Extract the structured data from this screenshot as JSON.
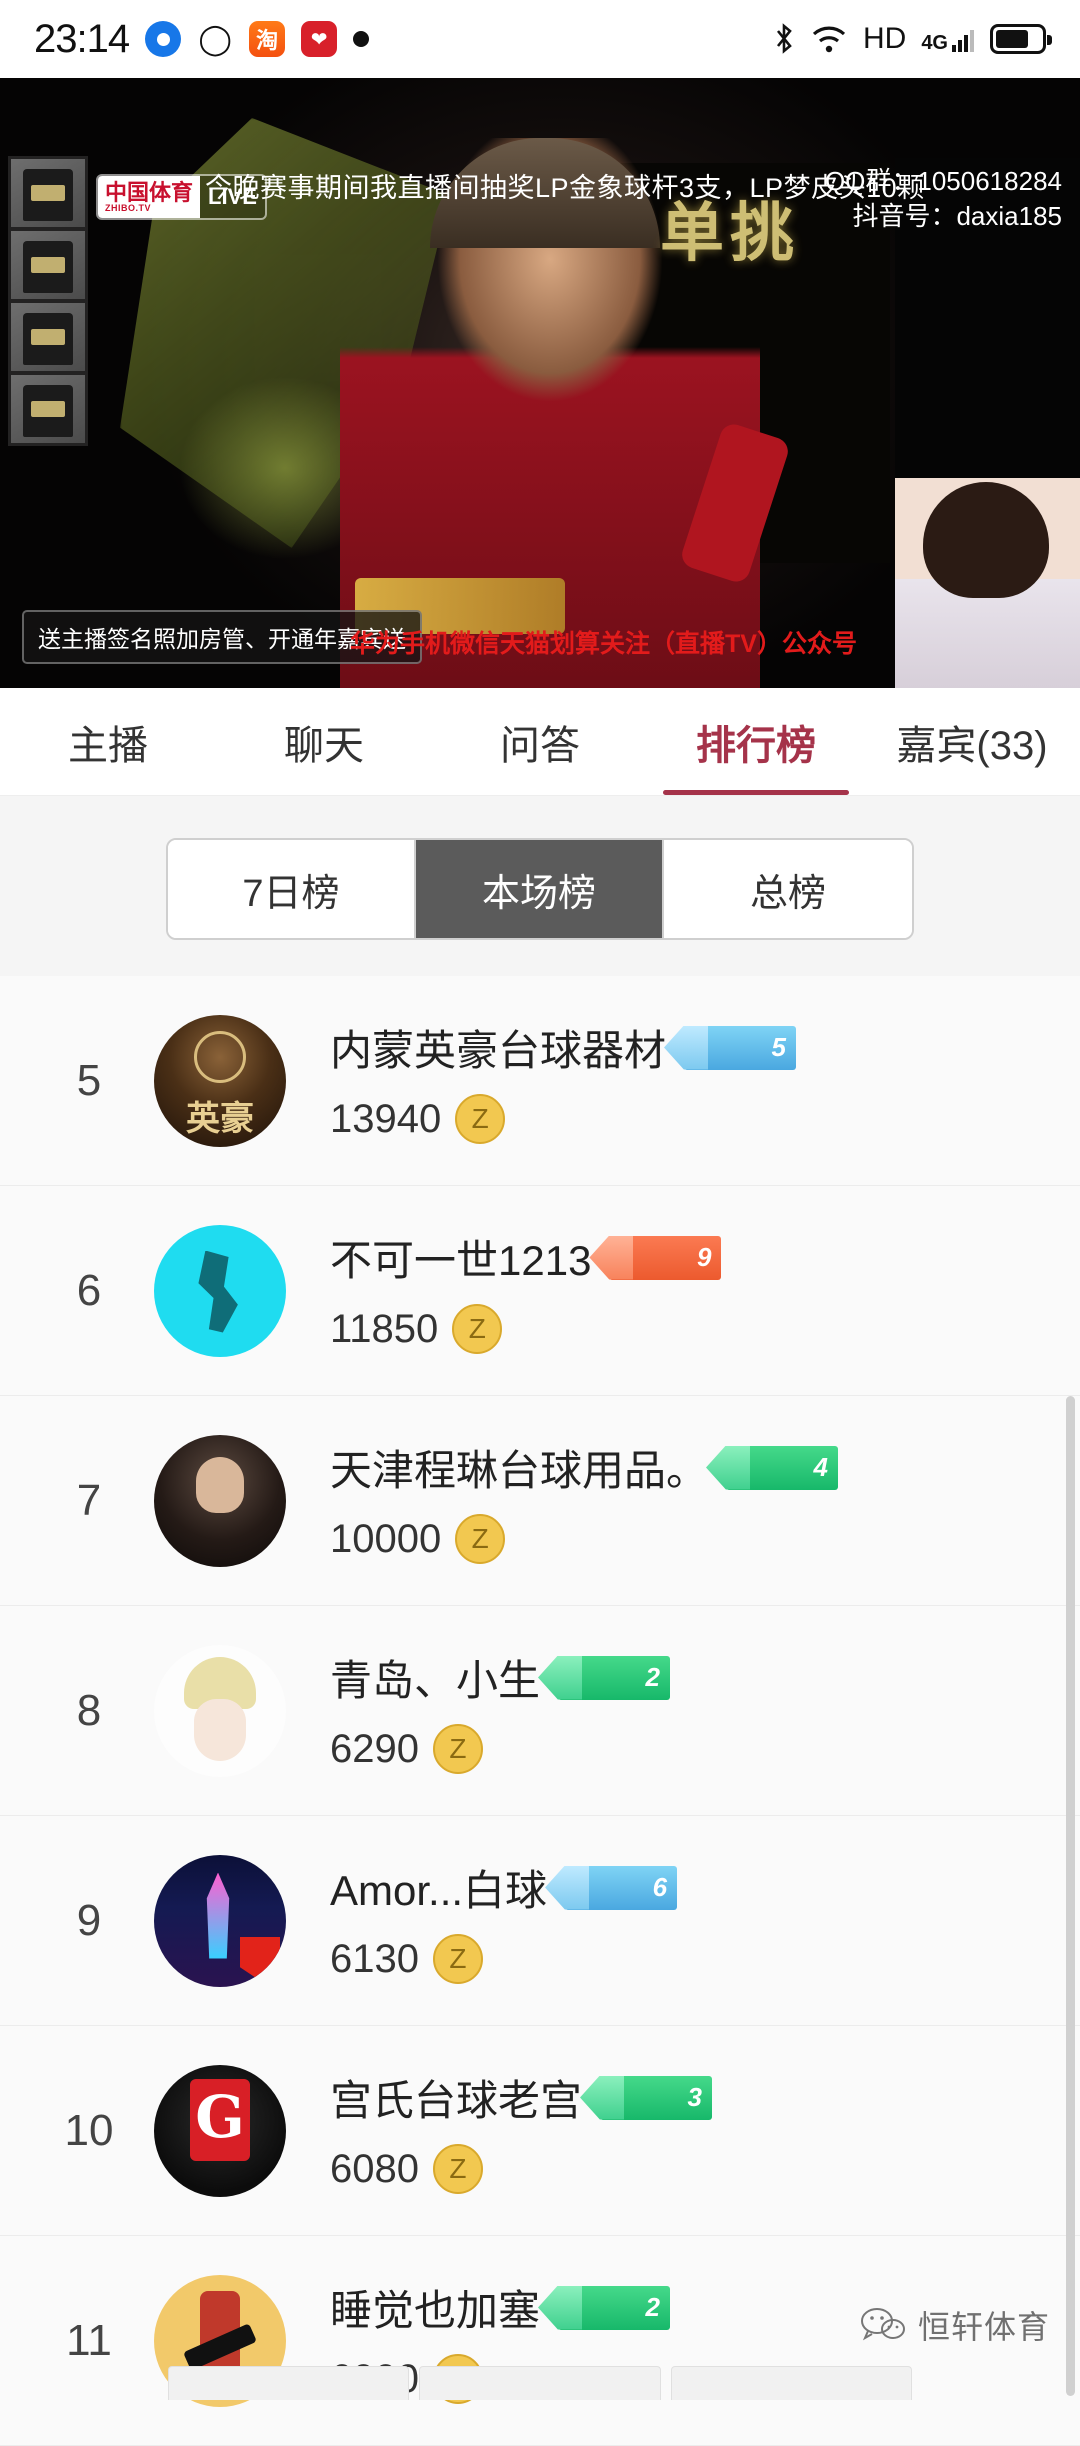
{
  "status_bar": {
    "time": "23:14",
    "icons_left": [
      "browser-icon",
      "qq-icon",
      "taobao-icon",
      "heart-app-icon",
      "dot-icon"
    ],
    "icons_right": [
      "bluetooth-icon",
      "wifi-icon",
      "hd-icon",
      "4g-signal-icon",
      "battery-icon"
    ],
    "hd_label": "HD",
    "network_label": "4G"
  },
  "player": {
    "live_badge_main": "中国体育",
    "live_badge_sub": "ZHIBO.TV",
    "live_badge_live": "LIVE",
    "marquee": "今晚赛事期间我直播间抽奖LP金象球杆3支，LP梦皮头10颗",
    "qq_group": "QQ群：1050618284",
    "douyin_id": "抖音号：daxia185",
    "logo_text": "单挑",
    "bottom_tag": "送主播签名照加房管、开通年嘉宾送",
    "bottom_red_text": "华为手机微信天猫划算关注（直播TV）公众号",
    "thumbnail_count": 4
  },
  "tabs": [
    {
      "label": "主播",
      "active": false
    },
    {
      "label": "聊天",
      "active": false
    },
    {
      "label": "问答",
      "active": false
    },
    {
      "label": "排行榜",
      "active": true
    },
    {
      "label": "嘉宾(33)",
      "active": false
    }
  ],
  "segmented": [
    {
      "label": "7日榜",
      "active": false
    },
    {
      "label": "本场榜",
      "active": true
    },
    {
      "label": "总榜",
      "active": false
    }
  ],
  "ranking": [
    {
      "rank": "5",
      "name": "内蒙英豪台球器材",
      "level": "5",
      "level_color": "blue",
      "score": "13940",
      "currency": "Z"
    },
    {
      "rank": "6",
      "name": "不可一世1213",
      "level": "9",
      "level_color": "orange",
      "score": "11850",
      "currency": "Z"
    },
    {
      "rank": "7",
      "name": "天津程琳台球用品。",
      "level": "4",
      "level_color": "green",
      "score": "10000",
      "currency": "Z"
    },
    {
      "rank": "8",
      "name": "青岛、小生",
      "level": "2",
      "level_color": "green",
      "score": "6290",
      "currency": "Z"
    },
    {
      "rank": "9",
      "name": "Amor...白球",
      "level": "6",
      "level_color": "blue",
      "score": "6130",
      "currency": "Z"
    },
    {
      "rank": "10",
      "name": "宫氏台球老宫",
      "level": "3",
      "level_color": "green",
      "score": "6080",
      "currency": "Z"
    },
    {
      "rank": "11",
      "name": "睡觉也加塞",
      "level": "2",
      "level_color": "green",
      "score": "6000",
      "currency": "Z"
    }
  ],
  "watermark": {
    "text": "恒轩体育"
  },
  "colors": {
    "accent_red": "#a5334a",
    "segment_active_bg": "#5b5b5b",
    "coin_yellow": "#f2c850",
    "level_green": "#17b86a",
    "level_blue": "#4aa8e0",
    "level_orange": "#ec5a2e",
    "page_bg": "#fafafa"
  }
}
